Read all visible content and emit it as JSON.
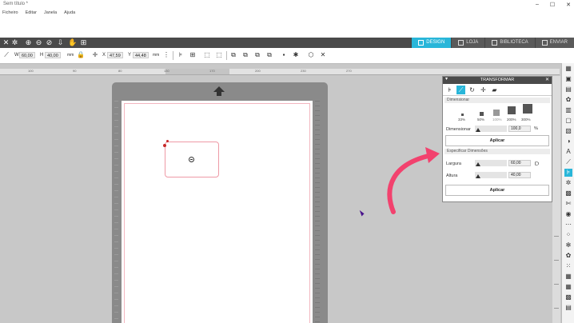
{
  "window": {
    "title": "Sem título *",
    "controls": [
      "–",
      "☐",
      "✕"
    ]
  },
  "menu": [
    "Ficheiro",
    "Editar",
    "Janela",
    "Ajuda"
  ],
  "tabs": [
    {
      "label": "DESIGN",
      "icon": "grid-icon",
      "active": true
    },
    {
      "label": "LOJA",
      "icon": "cloud-icon",
      "active": false
    },
    {
      "label": "BIBLIOTECA",
      "icon": "library-icon",
      "active": false
    },
    {
      "label": "ENVIAR",
      "icon": "send-icon",
      "active": false
    }
  ],
  "toolbar": {
    "w_label": "W",
    "w_value": "60,00",
    "h_label": "H",
    "h_value": "40,00",
    "unit": "mm",
    "x_label": "X",
    "x_value": "47,59",
    "y_label": "Y",
    "y_value": "44,48",
    "unit2": "mm"
  },
  "ruler": {
    "ticks": [
      "100",
      "90",
      "80",
      "130",
      "170",
      "200",
      "230",
      "270"
    ]
  },
  "panel": {
    "title": "TRANSFORMAR",
    "section1": "Dimensionar",
    "scale_options": [
      "33%",
      "50%",
      "100%",
      "200%",
      "300%"
    ],
    "scale_label": "Dimensionar",
    "scale_value": "100,0",
    "scale_unit": "%",
    "apply1": "Aplicar",
    "section2": "Especificar Dimensões",
    "width_label": "Largura",
    "width_value": "60,00",
    "height_label": "Altura",
    "height_value": "40,00",
    "apply2": "Aplicar"
  },
  "colors": {
    "accent": "#29b6d9",
    "arrow": "#f2426e",
    "toolbar_dark": "#4a4a4a"
  }
}
